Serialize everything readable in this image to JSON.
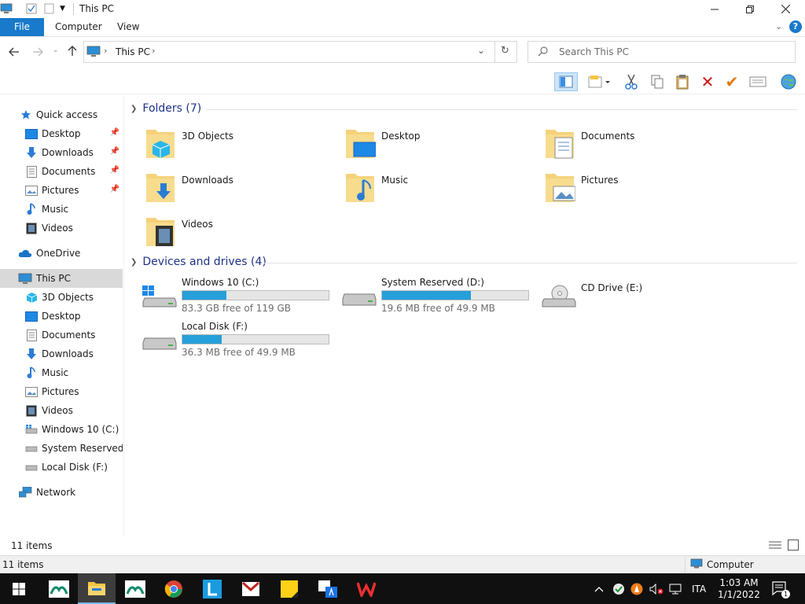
{
  "window": {
    "title": "This PC"
  },
  "ribbon": {
    "tabs": [
      "File",
      "Computer",
      "View"
    ]
  },
  "address": {
    "crumb": "This PC"
  },
  "search": {
    "placeholder": "Search This PC"
  },
  "nav": {
    "quick_access": "Quick access",
    "quick_items": [
      "Desktop",
      "Downloads",
      "Documents",
      "Pictures",
      "Music",
      "Videos"
    ],
    "onedrive": "OneDrive",
    "this_pc": "This PC",
    "pc_items": [
      "3D Objects",
      "Desktop",
      "Documents",
      "Downloads",
      "Music",
      "Pictures",
      "Videos",
      "Windows 10 (C:)",
      "System Reserved (D",
      "Local Disk (F:)"
    ],
    "network": "Network"
  },
  "content": {
    "folders_header": "Folders (7)",
    "folders": [
      "3D Objects",
      "Desktop",
      "Documents",
      "Downloads",
      "Music",
      "Pictures",
      "Videos"
    ],
    "drives_header": "Devices and drives (4)",
    "drives": [
      {
        "name": "Windows 10 (C:)",
        "free": "83.3 GB free of 119 GB",
        "used_fraction": 0.3
      },
      {
        "name": "System Reserved (D:)",
        "free": "19.6 MB free of 49.9 MB",
        "used_fraction": 0.61
      },
      {
        "name": "CD Drive (E:)"
      },
      {
        "name": "Local Disk (F:)",
        "free": "36.3 MB free of 49.9 MB",
        "used_fraction": 0.27
      }
    ]
  },
  "status": {
    "items": "11 items",
    "items2": "11 items",
    "zone": "Computer"
  },
  "taskbar": {
    "lang": "ITA",
    "time": "1:03 AM",
    "date": "1/1/2022",
    "notif_count": "1"
  },
  "colors": {
    "accent": "#1979ca",
    "bar_fill": "#26a0da",
    "folder": "#f5d27a",
    "header_text": "#1e3287"
  }
}
